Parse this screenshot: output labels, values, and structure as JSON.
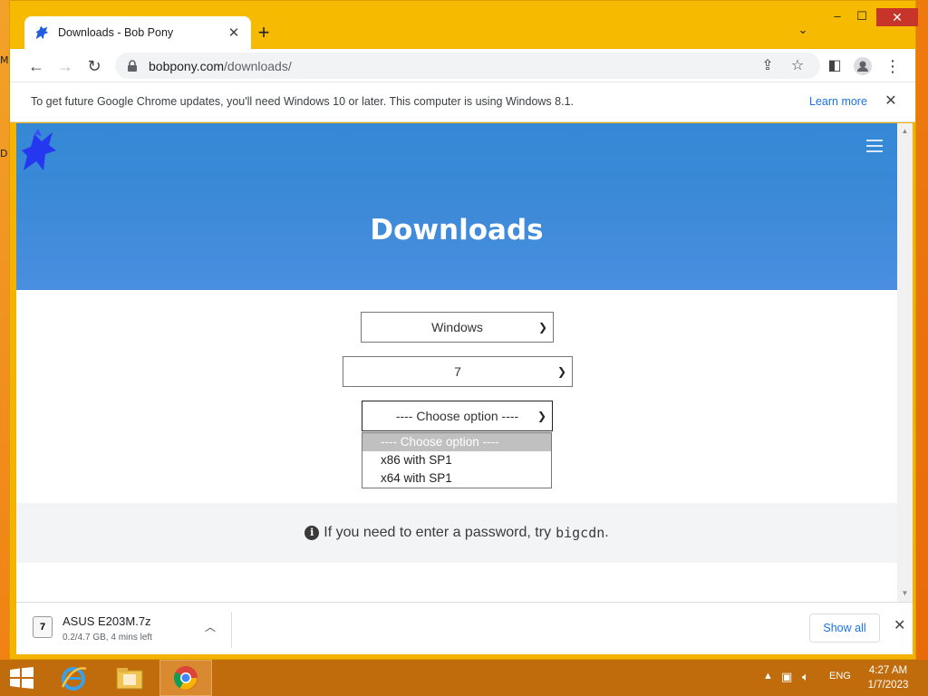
{
  "desktop": {
    "glyphs": [
      "M",
      "D"
    ]
  },
  "tab": {
    "title": "Downloads - Bob Pony",
    "close": "✕"
  },
  "window_controls": {
    "minimize": "–",
    "maximize": "☐",
    "close": "✕"
  },
  "toolbar": {
    "url_host": "bobpony.com",
    "url_path": "/downloads/"
  },
  "infobar": {
    "message": "To get future Google Chrome updates, you'll need Windows 10 or later. This computer is using Windows 8.1.",
    "link": "Learn more",
    "close": "✕"
  },
  "page": {
    "title": "Downloads",
    "selects": {
      "os": "Windows",
      "version": "7",
      "edition": "---- Choose option ----"
    },
    "dropdown_options": [
      "---- Choose option ----",
      "x86 with SP1",
      "x64 with SP1"
    ],
    "selected_option_index": 0,
    "notice_text": "If you need to enter a password, try",
    "notice_code": "bigcdn",
    "notice_end": "."
  },
  "download_shelf": {
    "file_name": "ASUS E203M.7z",
    "status": "0.2/4.7 GB, 4 mins left",
    "show_all": "Show all",
    "close": "✕"
  },
  "taskbar": {
    "language": "ENG",
    "time": "4:27 AM",
    "date": "1/7/2023"
  },
  "colors": {
    "hero": "#3f8bd9",
    "accent_link": "#1a73e8",
    "titlebar": "#f6ba00",
    "taskbar": "#c16c0c"
  }
}
